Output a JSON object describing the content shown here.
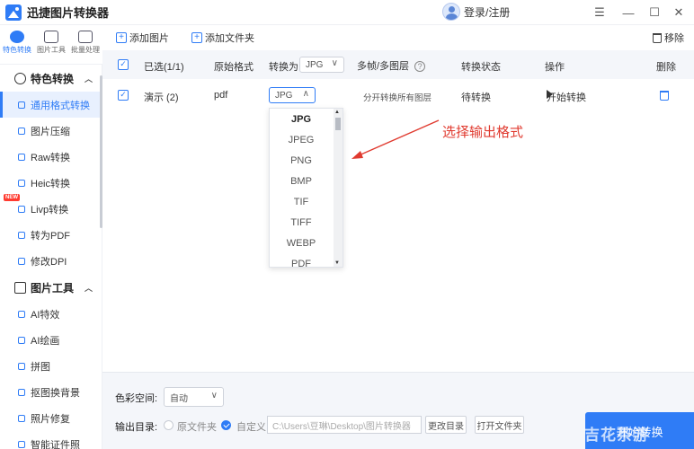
{
  "app": {
    "title": "迅捷图片转换器",
    "login": "登录/注册"
  },
  "window_controls": {
    "menu": "☰",
    "minimize": "—",
    "maximize": "☐",
    "close": "✕"
  },
  "left_tabs": [
    {
      "label": "特色转换",
      "active": true
    },
    {
      "label": "图片工具",
      "active": false
    },
    {
      "label": "批量处理",
      "active": false
    }
  ],
  "sidebar": {
    "section1": {
      "title": "特色转换"
    },
    "items1": [
      {
        "label": "通用格式转换",
        "active": true
      },
      {
        "label": "图片压缩"
      },
      {
        "label": "Raw转换"
      },
      {
        "label": "Heic转换"
      },
      {
        "label": "Livp转换",
        "badge": "NEW"
      },
      {
        "label": "转为PDF"
      },
      {
        "label": "修改DPI"
      }
    ],
    "section2": {
      "title": "图片工具"
    },
    "items2": [
      {
        "label": "AI特效"
      },
      {
        "label": "AI绘画"
      },
      {
        "label": "拼图"
      },
      {
        "label": "抠图换背景"
      },
      {
        "label": "照片修复"
      },
      {
        "label": "智能证件照"
      }
    ]
  },
  "toolbar": {
    "add_image": "添加图片",
    "add_folder": "添加文件夹",
    "remove": "移除"
  },
  "table": {
    "headers": {
      "selected": "已选(1/1)",
      "original_format": "原始格式",
      "convert_to": "转换为",
      "convert_to_value": "JPG",
      "multi_frame": "多帧/多图层",
      "status": "转换状态",
      "action": "操作",
      "delete": "删除"
    },
    "rows": [
      {
        "name": "演示 (2)",
        "format": "pdf",
        "target": "JPG",
        "frames": "分开转换所有图层",
        "status": "待转换",
        "action": "开始转换"
      }
    ]
  },
  "dropdown": {
    "options": [
      "JPG",
      "JPEG",
      "PNG",
      "BMP",
      "TIF",
      "TIFF",
      "WEBP",
      "PDF"
    ],
    "selected": "JPG"
  },
  "annotation": "选择输出格式",
  "bottom": {
    "color_space_label": "色彩空间:",
    "color_space_value": "自动",
    "output_label": "输出目录:",
    "original_folder": "原文件夹",
    "custom": "自定义",
    "path": "C:\\Users\\豆琳\\Desktop\\图片转换器",
    "change_dir": "更改目录",
    "open_folder": "打开文件夹",
    "start": "开始转换"
  },
  "watermark": "吉花茶游"
}
